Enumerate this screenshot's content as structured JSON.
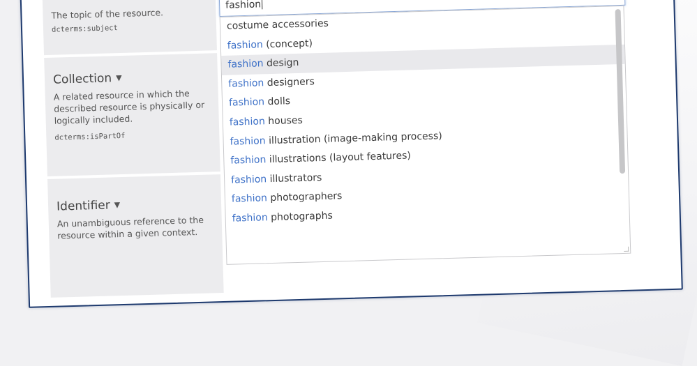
{
  "properties": [
    {
      "title": "",
      "description": "The topic of the resource.",
      "term": "dcterms:subject"
    },
    {
      "title": "Collection",
      "description": "A related resource in which the described resource is physically or logically included.",
      "term": "dcterms:isPartOf"
    },
    {
      "title": "Identifier",
      "description": "An unambiguous reference to the resource within a given context.",
      "term": ""
    }
  ],
  "search": {
    "value": "fashion",
    "match_color": "#3f72c8"
  },
  "suggestions": [
    {
      "match": "",
      "rest": "costume accessories"
    },
    {
      "match": "fashion",
      "rest": " (concept)"
    },
    {
      "match": "fashion",
      "rest": " design"
    },
    {
      "match": "fashion",
      "rest": " designers"
    },
    {
      "match": "fashion",
      "rest": " dolls"
    },
    {
      "match": "fashion",
      "rest": " houses"
    },
    {
      "match": "fashion",
      "rest": " illustration (image-making process)"
    },
    {
      "match": "fashion",
      "rest": " illustrations (layout features)"
    },
    {
      "match": "fashion",
      "rest": " illustrators"
    },
    {
      "match": "fashion",
      "rest": " photographers"
    },
    {
      "match": "fashion",
      "rest": " photographs"
    }
  ],
  "highlighted_index": 2
}
